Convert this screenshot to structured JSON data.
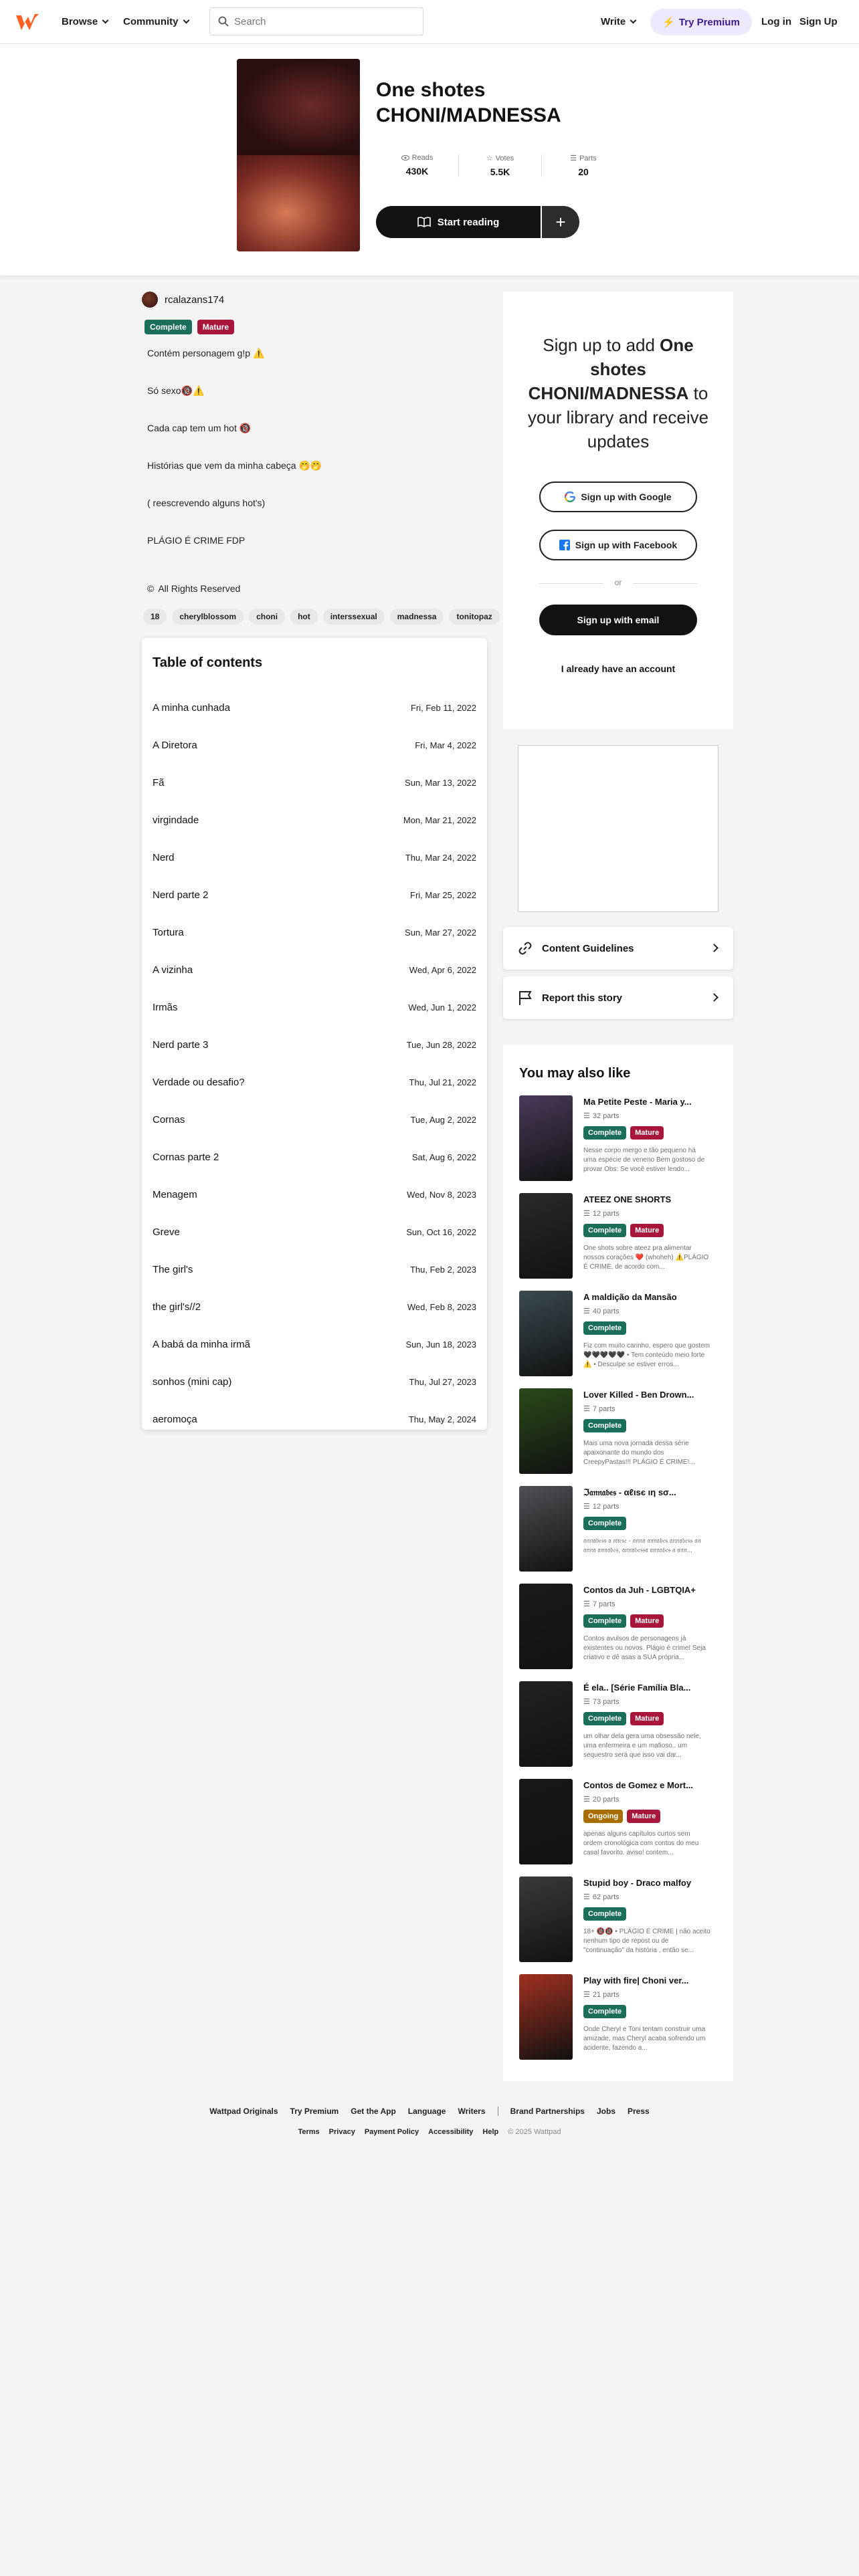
{
  "nav": {
    "browse": "Browse",
    "community": "Community",
    "search_placeholder": "Search",
    "write": "Write",
    "premium": "Try Premium",
    "login": "Log in",
    "signup": "Sign Up"
  },
  "story": {
    "title": "One shotes CHONI/MADNESSA",
    "reads_label": "Reads",
    "reads": "430K",
    "votes_label": "Votes",
    "votes": "5.5K",
    "parts_label": "Parts",
    "parts": "20",
    "start_reading": "Start reading",
    "author": "rcalazans174",
    "status_complete": "Complete",
    "status_mature": "Mature",
    "description": [
      "Contém personagem g!p ⚠️",
      "Só sexo🔞⚠️",
      "Cada cap tem um hot 🔞",
      "Histórias que vem da minha cabeça 🤭🤭",
      "( reescrevendo alguns hot's)",
      "PLÁGIO É CRIME FDP"
    ],
    "rights": "All Rights Reserved",
    "tags": [
      "18",
      "cherylblossom",
      "choni",
      "hot",
      "interssexual",
      "madnessa",
      "tonitopaz"
    ]
  },
  "toc": {
    "heading": "Table of contents",
    "items": [
      {
        "title": "A minha cunhada",
        "date": "Fri, Feb 11, 2022"
      },
      {
        "title": "A Diretora",
        "date": "Fri, Mar 4, 2022"
      },
      {
        "title": "Fã",
        "date": "Sun, Mar 13, 2022"
      },
      {
        "title": "virgindade",
        "date": "Mon, Mar 21, 2022"
      },
      {
        "title": "Nerd",
        "date": "Thu, Mar 24, 2022"
      },
      {
        "title": "Nerd parte 2",
        "date": "Fri, Mar 25, 2022"
      },
      {
        "title": "Tortura",
        "date": "Sun, Mar 27, 2022"
      },
      {
        "title": "A vizinha",
        "date": "Wed, Apr 6, 2022"
      },
      {
        "title": "Irmãs",
        "date": "Wed, Jun 1, 2022"
      },
      {
        "title": "Nerd parte 3",
        "date": "Tue, Jun 28, 2022"
      },
      {
        "title": "Verdade ou desafio?",
        "date": "Thu, Jul 21, 2022"
      },
      {
        "title": "Cornas",
        "date": "Tue, Aug 2, 2022"
      },
      {
        "title": "Cornas parte 2",
        "date": "Sat, Aug 6, 2022"
      },
      {
        "title": "Menagem",
        "date": "Wed, Nov 8, 2023"
      },
      {
        "title": "Greve",
        "date": "Sun, Oct 16, 2022"
      },
      {
        "title": "The girl's",
        "date": "Thu, Feb 2, 2023"
      },
      {
        "title": "the girl's//2",
        "date": "Wed, Feb 8, 2023"
      },
      {
        "title": "A babá da minha irmã",
        "date": "Sun, Jun 18, 2023"
      },
      {
        "title": "sonhos (mini cap)",
        "date": "Thu, Jul 27, 2023"
      },
      {
        "title": "aeromoça",
        "date": "Thu, May 2, 2024"
      }
    ]
  },
  "signup": {
    "pre": "Sign up to add ",
    "story": "One shotes CHONI/MADNESSA",
    "post": " to your library and receive updates",
    "google": "Sign up with Google",
    "facebook": "Sign up with Facebook",
    "or": "or",
    "email": "Sign up with email",
    "have_account": "I already have an account"
  },
  "links": {
    "guidelines": "Content Guidelines",
    "report": "Report this story"
  },
  "also": {
    "heading": "You may also like",
    "items": [
      {
        "title": "Ma Petite Peste - Maria y...",
        "parts": "32 parts",
        "badges": [
          "Complete",
          "Mature"
        ],
        "desc": "Nesse corpo mergo e tão pequeno há uma espécie de veneno Bem gostoso de provar Obs: Se você estiver lendo...",
        "color": "#4a3a5a"
      },
      {
        "title": "ATEEZ ONE SHORTS",
        "parts": "12 parts",
        "badges": [
          "Complete",
          "Mature"
        ],
        "desc": "One shots sobre ateez pra alimentar nossos corações ❤️ (whoheh) ⚠️PLÁGIO É CRIME, de acordo com...",
        "color": "#2a2a2a"
      },
      {
        "title": "A maldição da Mansão",
        "parts": "40 parts",
        "badges": [
          "Complete"
        ],
        "desc": "Fiz com muito carinho, espero que gostem 🖤🖤🖤🖤🖤 • Tem conteúdo meio forte ⚠️ • Desculpe se estiver erros...",
        "color": "#3a4a50"
      },
      {
        "title": "Lover Killed - Ben Drown...",
        "parts": "7 parts",
        "badges": [
          "Complete"
        ],
        "desc": "Mais uma nova jornada dessa série apaixonante do mundo dos CreepyPastas!!! PLÁGIO É CRIME!...",
        "color": "#2a4a1a"
      },
      {
        "title": "ℑ𝔞𝔫𝔫𝔞𝔟𝔢𝔰 - αℓιѕє ιη ѕσ...",
        "parts": "12 parts",
        "badges": [
          "Complete"
        ],
        "desc": "𝔞𝔫𝔫𝔞𝔟𝔢𝔰𝔰 𝔞 𝔬𝔫𝔢𝔰𝔢 - 𝔞𝔫𝔫𝔞 𝔞𝔫𝔫𝔞𝔟𝔢𝔰 𝔞𝔫𝔫𝔞𝔟𝔢𝔰𝔰 𝔞𝔫 𝔞𝔫𝔫𝔞 𝔞𝔫𝔫𝔞𝔟𝔢𝔰, 𝔞𝔫𝔫𝔞𝔟𝔢𝔰𝔰𝔞 𝔞𝔫𝔫𝔞𝔟𝔢𝔰 𝔞 𝔞𝔫𝔫...",
        "color": "#505055"
      },
      {
        "title": "Contos da Juh - LGBTQIA+",
        "parts": "7 parts",
        "badges": [
          "Complete",
          "Mature"
        ],
        "desc": "Contos avulsos de personagens já existentes ou novos. Plágio é crime! Seja criativo e dê asas a SUA própria...",
        "color": "#1a1a1a"
      },
      {
        "title": "É ela.. [Série Família Bla...",
        "parts": "73 parts",
        "badges": [
          "Complete",
          "Mature"
        ],
        "desc": "um olhar dela gera uma obsessão nele, uma enfermeira e um mafioso.. um sequestro será que isso vai dar...",
        "color": "#222"
      },
      {
        "title": "Contos de Gomez e Mort...",
        "parts": "20 parts",
        "badges": [
          "Ongoing",
          "Mature"
        ],
        "desc": "apenas alguns capítulos curtos sem ordem cronológica com contos do meu casal favorito. aviso! contem...",
        "color": "#181818"
      },
      {
        "title": "Stupid boy - Draco malfoy",
        "parts": "62 parts",
        "badges": [
          "Complete"
        ],
        "desc": "18+ 🔞🔞 • PLÁGIO É CRIME | não aceito nenhum tipo de repost ou de \"continuação\" da história , então se...",
        "color": "#3a3a3a"
      },
      {
        "title": "Play with fire| Choni ver...",
        "parts": "21 parts",
        "badges": [
          "Complete"
        ],
        "desc": "Onde Cheryl e Toni tentam construir uma amizade, mas Cheryl acaba sofrendo um acidente, fazendo a...",
        "color": "#a03020"
      }
    ]
  },
  "footer": {
    "row1": [
      "Wattpad Originals",
      "Try Premium",
      "Get the App",
      "Language",
      "Writers",
      "Brand Partnerships",
      "Jobs",
      "Press"
    ],
    "row2": [
      "Terms",
      "Privacy",
      "Payment Policy",
      "Accessibility",
      "Help"
    ],
    "copy": "© 2025 Wattpad"
  },
  "colors": {
    "brand": "#ff6122",
    "complete": "#1b6f5a",
    "mature": "#a8163c",
    "ongoing": "#a86f00"
  }
}
